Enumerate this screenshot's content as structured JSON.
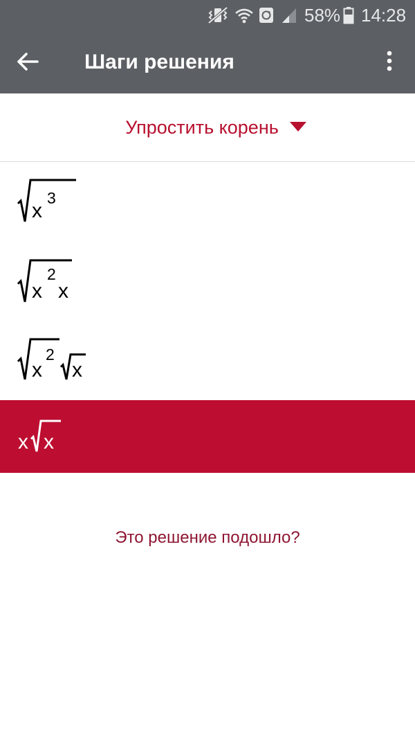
{
  "status_bar": {
    "battery": "58%",
    "time": "14:28",
    "icons": [
      "vibrate-mute-icon",
      "wifi-icon",
      "sync-icon",
      "signal-icon",
      "battery-icon"
    ]
  },
  "app_bar": {
    "title": "Шаги решения",
    "back_icon": "arrow-left-icon",
    "menu_icon": "more-vert-icon"
  },
  "method_dropdown": {
    "label": "Упростить корень",
    "icon": "caret-down-icon"
  },
  "steps": [
    {
      "expr": "√(x^3)",
      "base": "x",
      "exponent": "3"
    },
    {
      "expr": "√(x^2 x)",
      "base": "x",
      "exponent": "2",
      "factor": "x"
    },
    {
      "expr": "√(x^2) √x",
      "base": "x",
      "exponent": "2",
      "radicand": "x"
    },
    {
      "expr": "x√x",
      "coefficient": "x",
      "radicand": "x"
    }
  ],
  "feedback_prompt": "Это решение подошло?",
  "colors": {
    "bar_background": "#5c5f63",
    "accent": "#bd0e31",
    "accent_text": "#b8102f",
    "feedback_text": "#8e1632"
  }
}
